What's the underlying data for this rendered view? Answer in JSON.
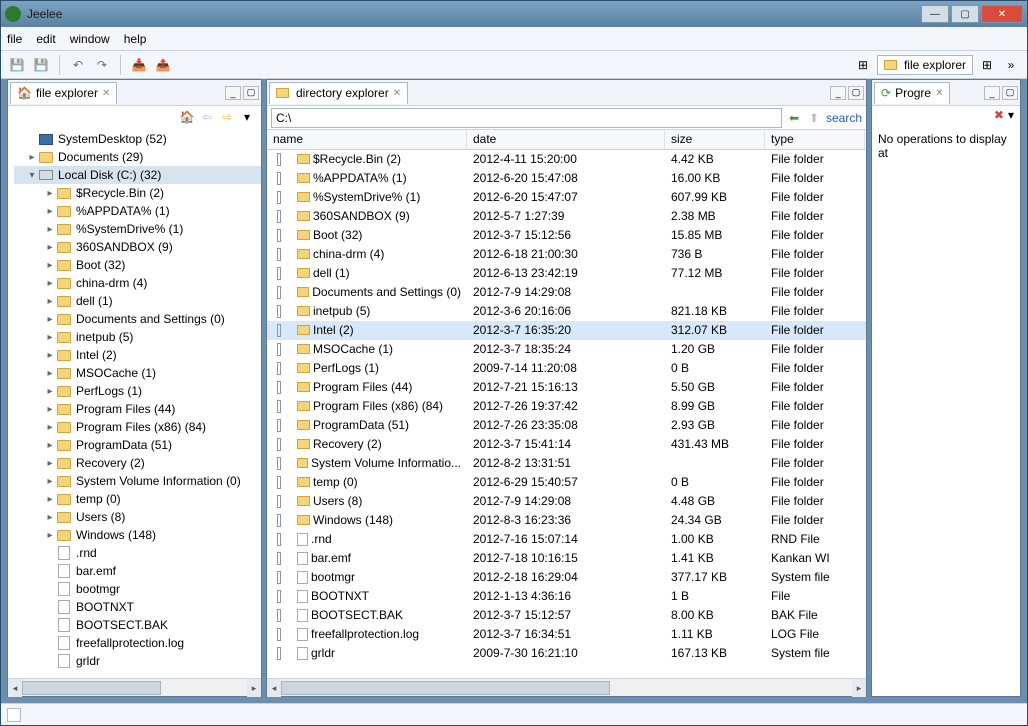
{
  "window": {
    "title": "Jeelee"
  },
  "menu": {
    "file": "file",
    "edit": "edit",
    "window": "window",
    "help": "help"
  },
  "perspectives": {
    "file_explorer": "file explorer"
  },
  "tabs": {
    "file_explorer": "file explorer",
    "directory_explorer": "directory explorer",
    "progress": "Progre"
  },
  "path": {
    "value": "C:\\",
    "search": "search"
  },
  "progress": {
    "empty": "No operations to display at"
  },
  "tree": [
    {
      "label": "SystemDesktop (52)",
      "indent": 0,
      "twist": "",
      "icon": "desktop"
    },
    {
      "label": "Documents (29)",
      "indent": 0,
      "twist": "▸",
      "icon": "folder"
    },
    {
      "label": "Local Disk (C:) (32)",
      "indent": 0,
      "twist": "▾",
      "icon": "drive",
      "sel": true
    },
    {
      "label": "$Recycle.Bin (2)",
      "indent": 1,
      "twist": "▸",
      "icon": "folder"
    },
    {
      "label": "%APPDATA% (1)",
      "indent": 1,
      "twist": "▸",
      "icon": "folder"
    },
    {
      "label": "%SystemDrive% (1)",
      "indent": 1,
      "twist": "▸",
      "icon": "folder"
    },
    {
      "label": "360SANDBOX (9)",
      "indent": 1,
      "twist": "▸",
      "icon": "folder"
    },
    {
      "label": "Boot (32)",
      "indent": 1,
      "twist": "▸",
      "icon": "folder"
    },
    {
      "label": "china-drm (4)",
      "indent": 1,
      "twist": "▸",
      "icon": "folder"
    },
    {
      "label": "dell (1)",
      "indent": 1,
      "twist": "▸",
      "icon": "folder"
    },
    {
      "label": "Documents and Settings (0)",
      "indent": 1,
      "twist": "▸",
      "icon": "folder"
    },
    {
      "label": "inetpub (5)",
      "indent": 1,
      "twist": "▸",
      "icon": "folder"
    },
    {
      "label": "Intel (2)",
      "indent": 1,
      "twist": "▸",
      "icon": "folder"
    },
    {
      "label": "MSOCache (1)",
      "indent": 1,
      "twist": "▸",
      "icon": "folder"
    },
    {
      "label": "PerfLogs (1)",
      "indent": 1,
      "twist": "▸",
      "icon": "folder"
    },
    {
      "label": "Program Files (44)",
      "indent": 1,
      "twist": "▸",
      "icon": "folder"
    },
    {
      "label": "Program Files (x86) (84)",
      "indent": 1,
      "twist": "▸",
      "icon": "folder"
    },
    {
      "label": "ProgramData (51)",
      "indent": 1,
      "twist": "▸",
      "icon": "folder"
    },
    {
      "label": "Recovery (2)",
      "indent": 1,
      "twist": "▸",
      "icon": "folder"
    },
    {
      "label": "System Volume Information (0)",
      "indent": 1,
      "twist": "▸",
      "icon": "folder"
    },
    {
      "label": "temp (0)",
      "indent": 1,
      "twist": "▸",
      "icon": "folder"
    },
    {
      "label": "Users (8)",
      "indent": 1,
      "twist": "▸",
      "icon": "folder"
    },
    {
      "label": "Windows (148)",
      "indent": 1,
      "twist": "▸",
      "icon": "folder"
    },
    {
      "label": ".rnd",
      "indent": 1,
      "twist": "",
      "icon": "file"
    },
    {
      "label": "bar.emf",
      "indent": 1,
      "twist": "",
      "icon": "file"
    },
    {
      "label": "bootmgr",
      "indent": 1,
      "twist": "",
      "icon": "file"
    },
    {
      "label": "BOOTNXT",
      "indent": 1,
      "twist": "",
      "icon": "file"
    },
    {
      "label": "BOOTSECT.BAK",
      "indent": 1,
      "twist": "",
      "icon": "file"
    },
    {
      "label": "freefallprotection.log",
      "indent": 1,
      "twist": "",
      "icon": "file"
    },
    {
      "label": "grldr",
      "indent": 1,
      "twist": "",
      "icon": "file"
    }
  ],
  "columns": {
    "name": "name",
    "date": "date",
    "size": "size",
    "type": "type"
  },
  "rows": [
    {
      "name": "$Recycle.Bin (2)",
      "date": "2012-4-11 15:20:00",
      "size": "4.42 KB",
      "type": "File folder",
      "icon": "folder"
    },
    {
      "name": "%APPDATA% (1)",
      "date": "2012-6-20 15:47:08",
      "size": "16.00 KB",
      "type": "File folder",
      "icon": "folder"
    },
    {
      "name": "%SystemDrive% (1)",
      "date": "2012-6-20 15:47:07",
      "size": "607.99 KB",
      "type": "File folder",
      "icon": "folder"
    },
    {
      "name": "360SANDBOX (9)",
      "date": "2012-5-7 1:27:39",
      "size": "2.38 MB",
      "type": "File folder",
      "icon": "folder"
    },
    {
      "name": "Boot (32)",
      "date": "2012-3-7 15:12:56",
      "size": "15.85 MB",
      "type": "File folder",
      "icon": "folder"
    },
    {
      "name": "china-drm (4)",
      "date": "2012-6-18 21:00:30",
      "size": "736 B",
      "type": "File folder",
      "icon": "folder"
    },
    {
      "name": "dell (1)",
      "date": "2012-6-13 23:42:19",
      "size": "77.12 MB",
      "type": "File folder",
      "icon": "folder"
    },
    {
      "name": "Documents and Settings (0)",
      "date": "2012-7-9 14:29:08",
      "size": "",
      "type": "File folder",
      "icon": "folder"
    },
    {
      "name": "inetpub (5)",
      "date": "2012-3-6 20:16:06",
      "size": "821.18 KB",
      "type": "File folder",
      "icon": "folder"
    },
    {
      "name": "Intel (2)",
      "date": "2012-3-7 16:35:20",
      "size": "312.07 KB",
      "type": "File folder",
      "icon": "folder",
      "sel": true
    },
    {
      "name": "MSOCache (1)",
      "date": "2012-3-7 18:35:24",
      "size": "1.20 GB",
      "type": "File folder",
      "icon": "folder"
    },
    {
      "name": "PerfLogs (1)",
      "date": "2009-7-14 11:20:08",
      "size": "0 B",
      "type": "File folder",
      "icon": "folder"
    },
    {
      "name": "Program Files (44)",
      "date": "2012-7-21 15:16:13",
      "size": "5.50 GB",
      "type": "File folder",
      "icon": "folder"
    },
    {
      "name": "Program Files (x86) (84)",
      "date": "2012-7-26 19:37:42",
      "size": "8.99 GB",
      "type": "File folder",
      "icon": "folder"
    },
    {
      "name": "ProgramData (51)",
      "date": "2012-7-26 23:35:08",
      "size": "2.93 GB",
      "type": "File folder",
      "icon": "folder"
    },
    {
      "name": "Recovery (2)",
      "date": "2012-3-7 15:41:14",
      "size": "431.43 MB",
      "type": "File folder",
      "icon": "folder"
    },
    {
      "name": "System Volume Informatio...",
      "date": "2012-8-2 13:31:51",
      "size": "",
      "type": "File folder",
      "icon": "folder"
    },
    {
      "name": "temp (0)",
      "date": "2012-6-29 15:40:57",
      "size": "0 B",
      "type": "File folder",
      "icon": "folder"
    },
    {
      "name": "Users (8)",
      "date": "2012-7-9 14:29:08",
      "size": "4.48 GB",
      "type": "File folder",
      "icon": "folder"
    },
    {
      "name": "Windows (148)",
      "date": "2012-8-3 16:23:36",
      "size": "24.34 GB",
      "type": "File folder",
      "icon": "folder"
    },
    {
      "name": ".rnd",
      "date": "2012-7-16 15:07:14",
      "size": "1.00 KB",
      "type": "RND File",
      "icon": "file"
    },
    {
      "name": "bar.emf",
      "date": "2012-7-18 10:16:15",
      "size": "1.41 KB",
      "type": "Kankan WI",
      "icon": "file"
    },
    {
      "name": "bootmgr",
      "date": "2012-2-18 16:29:04",
      "size": "377.17 KB",
      "type": "System file",
      "icon": "file"
    },
    {
      "name": "BOOTNXT",
      "date": "2012-1-13 4:36:16",
      "size": "1 B",
      "type": "File",
      "icon": "file"
    },
    {
      "name": "BOOTSECT.BAK",
      "date": "2012-3-7 15:12:57",
      "size": "8.00 KB",
      "type": "BAK File",
      "icon": "file"
    },
    {
      "name": "freefallprotection.log",
      "date": "2012-3-7 16:34:51",
      "size": "1.11 KB",
      "type": "LOG File",
      "icon": "file"
    },
    {
      "name": "grldr",
      "date": "2009-7-30 16:21:10",
      "size": "167.13 KB",
      "type": "System file",
      "icon": "file"
    }
  ]
}
